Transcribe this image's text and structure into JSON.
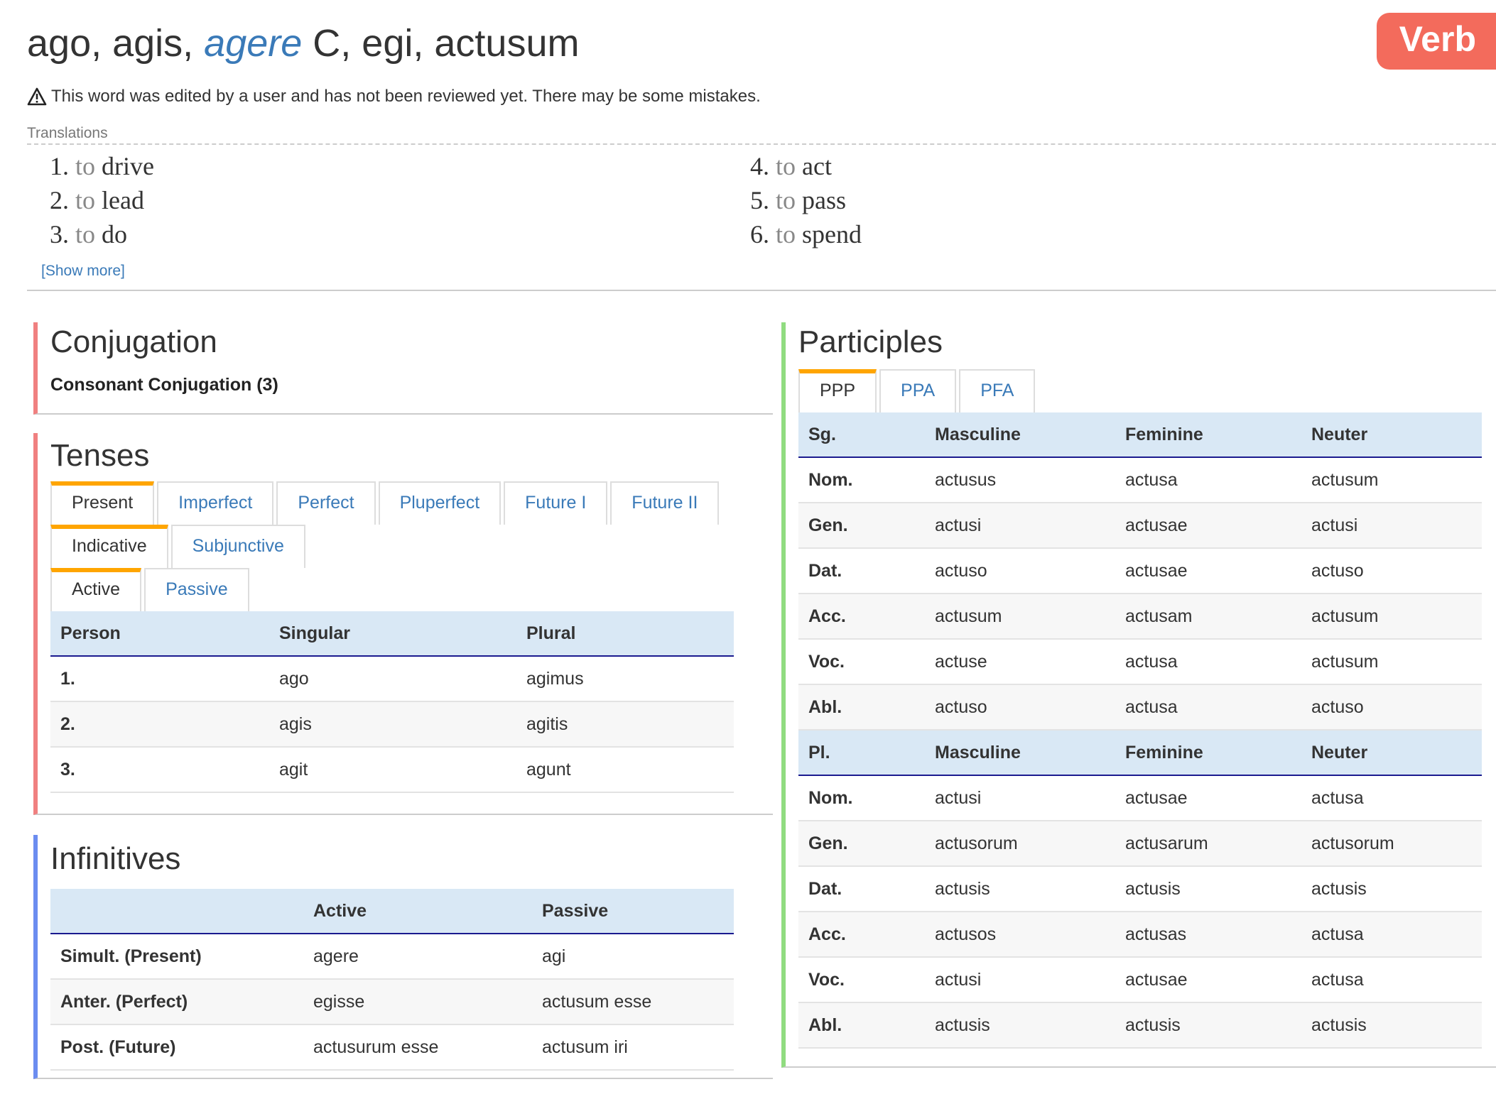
{
  "header": {
    "title_prefix": "ago, agis, ",
    "title_lemma": "agere",
    "title_suffix": " C, egi, actusum",
    "badge": "Verb",
    "warning": "This word was edited by a user and has not been reviewed yet. There may be some mistakes.",
    "translations_label": "Translations",
    "translations": [
      {
        "num": "1.",
        "to": "to",
        "word": "drive"
      },
      {
        "num": "2.",
        "to": "to",
        "word": "lead"
      },
      {
        "num": "3.",
        "to": "to",
        "word": "do"
      },
      {
        "num": "4.",
        "to": "to",
        "word": "act"
      },
      {
        "num": "5.",
        "to": "to",
        "word": "pass"
      },
      {
        "num": "6.",
        "to": "to",
        "word": "spend"
      }
    ],
    "show_more": "[Show more]"
  },
  "conjugation": {
    "title": "Conjugation",
    "subtitle": "Consonant Conjugation (3)"
  },
  "tenses": {
    "title": "Tenses",
    "tense_tabs": [
      "Present",
      "Imperfect",
      "Perfect",
      "Pluperfect",
      "Future I",
      "Future II"
    ],
    "mood_tabs": [
      "Indicative",
      "Subjunctive"
    ],
    "voice_tabs": [
      "Active",
      "Passive"
    ],
    "headers": [
      "Person",
      "Singular",
      "Plural"
    ],
    "rows": [
      [
        "1.",
        "ago",
        "agimus"
      ],
      [
        "2.",
        "agis",
        "agitis"
      ],
      [
        "3.",
        "agit",
        "agunt"
      ]
    ]
  },
  "infinitives": {
    "title": "Infinitives",
    "headers": [
      "",
      "Active",
      "Passive"
    ],
    "rows": [
      [
        "Simult. (Present)",
        "agere",
        "agi"
      ],
      [
        "Anter. (Perfect)",
        "egisse",
        "actusum esse"
      ],
      [
        "Post. (Future)",
        "actusurum esse",
        "actusum iri"
      ]
    ]
  },
  "participles": {
    "title": "Participles",
    "tabs": [
      "PPP",
      "PPA",
      "PFA"
    ],
    "sg_headers": [
      "Sg.",
      "Masculine",
      "Feminine",
      "Neuter"
    ],
    "sg_rows": [
      [
        "Nom.",
        "actusus",
        "actusa",
        "actusum"
      ],
      [
        "Gen.",
        "actusi",
        "actusae",
        "actusi"
      ],
      [
        "Dat.",
        "actuso",
        "actusae",
        "actuso"
      ],
      [
        "Acc.",
        "actusum",
        "actusam",
        "actusum"
      ],
      [
        "Voc.",
        "actuse",
        "actusa",
        "actusum"
      ],
      [
        "Abl.",
        "actuso",
        "actusa",
        "actuso"
      ]
    ],
    "pl_headers": [
      "Pl.",
      "Masculine",
      "Feminine",
      "Neuter"
    ],
    "pl_rows": [
      [
        "Nom.",
        "actusi",
        "actusae",
        "actusa"
      ],
      [
        "Gen.",
        "actusorum",
        "actusarum",
        "actusorum"
      ],
      [
        "Dat.",
        "actusis",
        "actusis",
        "actusis"
      ],
      [
        "Acc.",
        "actusos",
        "actusas",
        "actusa"
      ],
      [
        "Voc.",
        "actusi",
        "actusae",
        "actusa"
      ],
      [
        "Abl.",
        "actusis",
        "actusis",
        "actusis"
      ]
    ]
  },
  "colors": {
    "accent_blue": "#3a7ab8",
    "badge": "#f36b5c",
    "active_tab": "#ffa500",
    "conjugation_border": "#f08080",
    "infinitives_border": "#6b8cf0",
    "participles_border": "#90dc80"
  }
}
